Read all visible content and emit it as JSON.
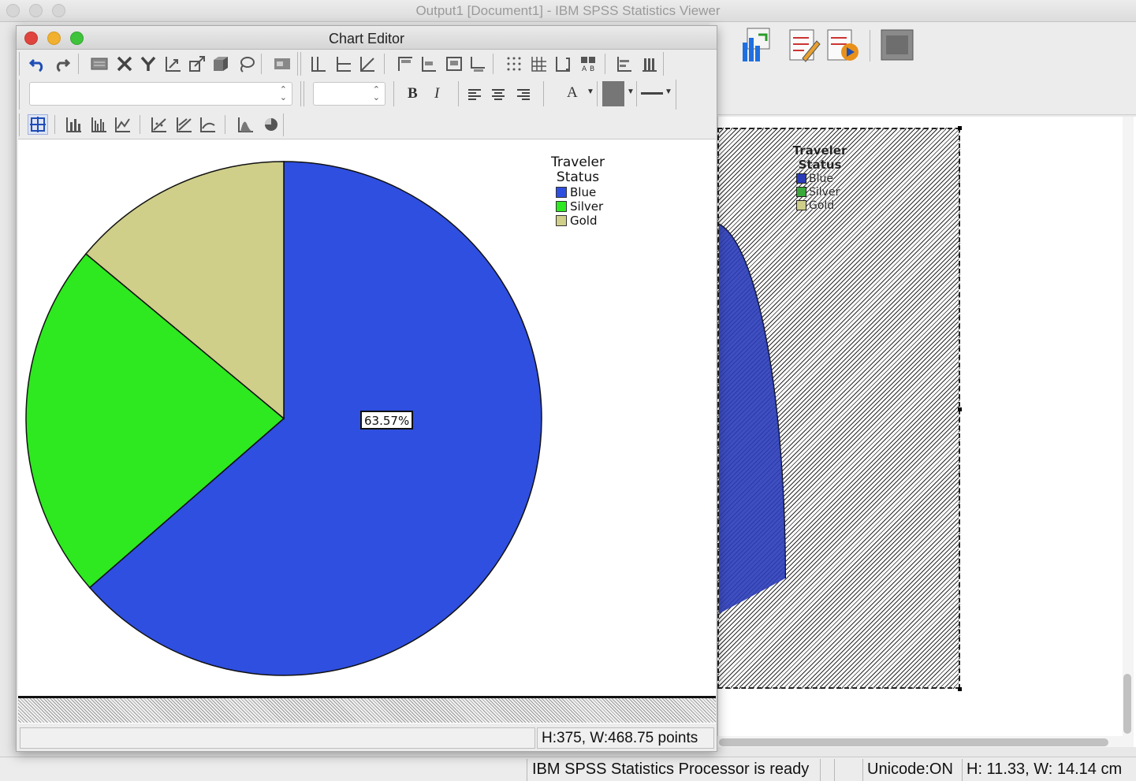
{
  "viewer": {
    "title": "Output1 [Document1] - IBM SPSS Statistics Viewer",
    "status": {
      "processor": "IBM SPSS Statistics Processor is ready",
      "unicode": "Unicode:ON",
      "size": "H: 11.33, W: 14.14 cm"
    },
    "background_legend": {
      "title_line1": "Traveler",
      "title_line2": "Status",
      "items": [
        "Blue",
        "Silver",
        "Gold"
      ]
    },
    "toolbar_icons": [
      "pivot-chart-icon",
      "edit-document-icon",
      "run-script-icon",
      "designate-window-icon"
    ]
  },
  "chart_editor": {
    "title": "Chart Editor",
    "status": {
      "size": "H:375, W:468.75 points"
    },
    "toolbar": {
      "row1_icons": [
        "undo-icon",
        "redo-icon",
        "properties-icon",
        "x-axis-icon",
        "y-axis-icon",
        "rescale-icon",
        "transpose-icon",
        "3d-rotate-icon",
        "lasso-icon",
        "data-label-mode-icon",
        "ref-line-y-icon",
        "ref-line-x-icon",
        "fit-line-icon",
        "title-icon",
        "annotation-icon",
        "textbox-icon",
        "footnote-icon",
        "grid-lines-icon",
        "grid-major-icon",
        "bracket-icon",
        "legend-icon",
        "distribution-icon",
        "bar-icon"
      ],
      "font_name": "",
      "font_size": "",
      "bold_label": "B",
      "italic_label": "I",
      "text_color_label": "A",
      "row3_icons": [
        "select-chart-icon",
        "bar-chart-icon",
        "clustered-bar-icon",
        "line-chart-icon",
        "scatter-icon",
        "scatter-fit-icon",
        "area-line-icon",
        "histogram-icon",
        "pie-chart-icon"
      ]
    }
  },
  "colors": {
    "blue": "#2F4FE0",
    "silver": "#2EE820",
    "gold": "#CFCF8A",
    "bg_blue": "#2A3CB8"
  },
  "chart_data": {
    "type": "pie",
    "legend_title": "Traveler Status",
    "legend_placement": "top-right",
    "slices": [
      {
        "label": "Blue",
        "value": 63.57,
        "color": "#2F4FE0",
        "data_label": "63.57%"
      },
      {
        "label": "Silver",
        "value": 22.5,
        "color": "#2EE820"
      },
      {
        "label": "Gold",
        "value": 13.93,
        "color": "#CFCF8A"
      }
    ]
  }
}
